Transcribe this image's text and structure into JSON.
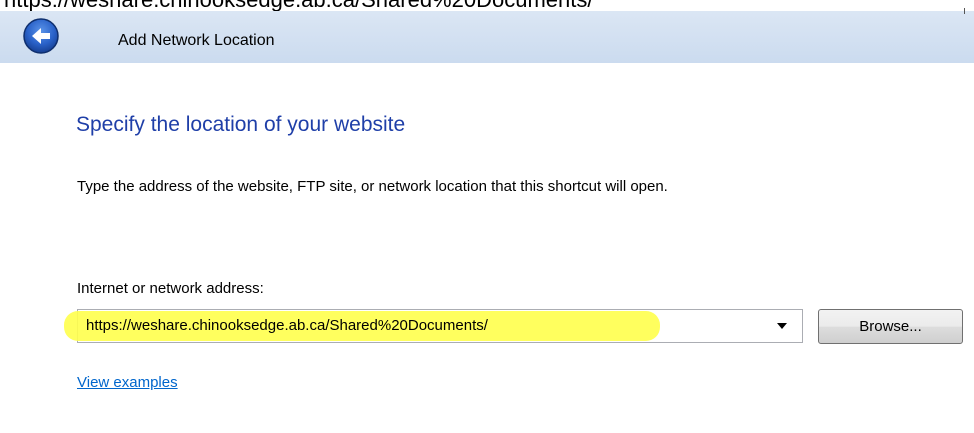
{
  "clipped_top_text": "https://weshare.chinooksedge.ab.ca/Shared%20Documents/",
  "window": {
    "title": "Add Network Location"
  },
  "content": {
    "heading": "Specify the location of your website",
    "description": "Type the address of the website, FTP site, or network location that this shortcut will open.",
    "address_label": "Internet or network address:",
    "address_value": "https://weshare.chinooksedge.ab.ca/Shared%20Documents/",
    "browse_label": "Browse...",
    "view_examples_label": "View examples"
  },
  "colors": {
    "heading": "#1f3fa8",
    "link": "#0066cc",
    "title_bar": "#cbdbef",
    "highlight": "#ffff4d",
    "back_button": "#2a62c9"
  },
  "icons": {
    "back": "back-arrow-icon",
    "dropdown": "chevron-down-icon"
  }
}
